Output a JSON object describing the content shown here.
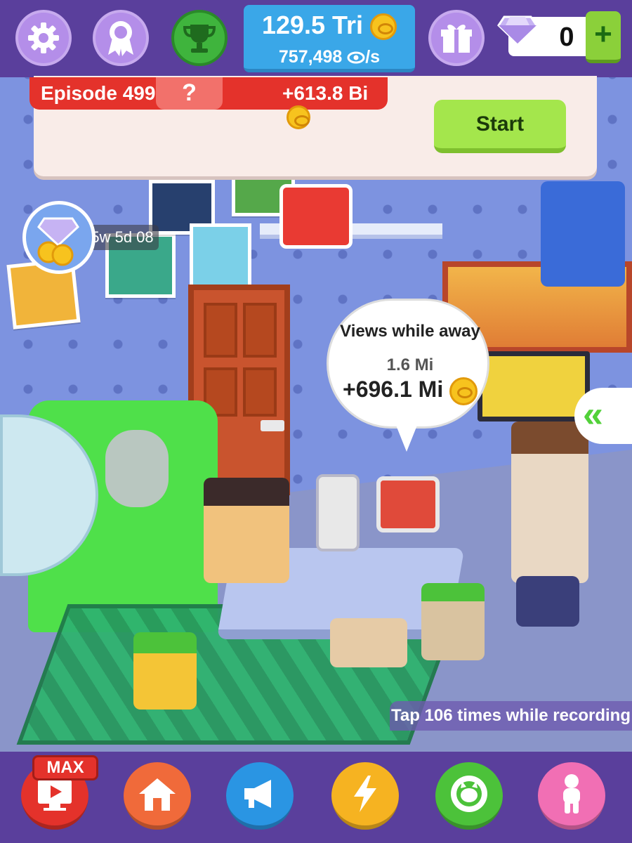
{
  "currency": {
    "views_total": "129.5 Tri",
    "views_rate": "757,498",
    "views_rate_unit": "/s",
    "gems": "0"
  },
  "top_buttons": {
    "settings": "gear-icon",
    "achievements": "ribbon-icon",
    "trophies": "trophy-icon",
    "gift": "gift-icon",
    "add_gems": "+"
  },
  "episode": {
    "title": "Episode 499",
    "mystery": "?",
    "reward": "+613.8 Bi",
    "start_label": "Start"
  },
  "timer": {
    "text": "5w 5d 08"
  },
  "away": {
    "title": "Views while away",
    "rate": "1.6 Mi",
    "total": "+696.1 Mi"
  },
  "side_panel": {
    "arrow": "«"
  },
  "hint": {
    "text": "Tap 106 times while recording"
  },
  "bottom_nav": {
    "max_badge": "MAX",
    "items": [
      "video-icon",
      "home-icon",
      "megaphone-icon",
      "lightning-icon",
      "cat-icon",
      "person-icon"
    ]
  },
  "colors": {
    "hud_bg": "#5a3f9c",
    "currency_bg": "#3aa7e8",
    "episode_red": "#e4322b",
    "start_green": "#a4e64c",
    "wall": "#7d93e0"
  }
}
